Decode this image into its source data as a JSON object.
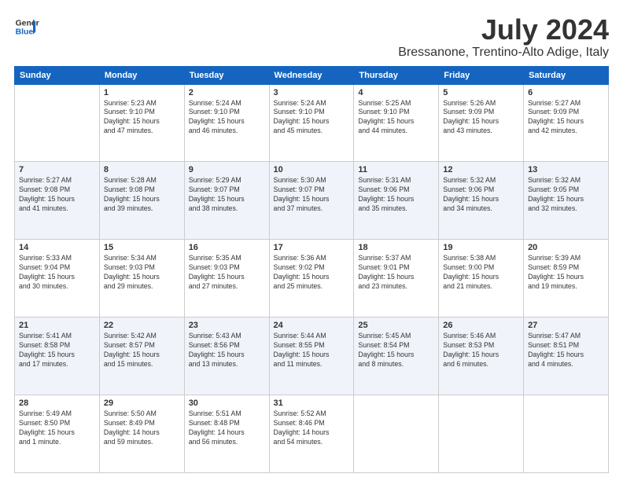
{
  "header": {
    "logo_line1": "General",
    "logo_line2": "Blue",
    "title": "July 2024",
    "subtitle": "Bressanone, Trentino-Alto Adige, Italy"
  },
  "columns": [
    "Sunday",
    "Monday",
    "Tuesday",
    "Wednesday",
    "Thursday",
    "Friday",
    "Saturday"
  ],
  "weeks": [
    [
      {
        "num": "",
        "info": ""
      },
      {
        "num": "1",
        "info": "Sunrise: 5:23 AM\nSunset: 9:10 PM\nDaylight: 15 hours\nand 47 minutes."
      },
      {
        "num": "2",
        "info": "Sunrise: 5:24 AM\nSunset: 9:10 PM\nDaylight: 15 hours\nand 46 minutes."
      },
      {
        "num": "3",
        "info": "Sunrise: 5:24 AM\nSunset: 9:10 PM\nDaylight: 15 hours\nand 45 minutes."
      },
      {
        "num": "4",
        "info": "Sunrise: 5:25 AM\nSunset: 9:10 PM\nDaylight: 15 hours\nand 44 minutes."
      },
      {
        "num": "5",
        "info": "Sunrise: 5:26 AM\nSunset: 9:09 PM\nDaylight: 15 hours\nand 43 minutes."
      },
      {
        "num": "6",
        "info": "Sunrise: 5:27 AM\nSunset: 9:09 PM\nDaylight: 15 hours\nand 42 minutes."
      }
    ],
    [
      {
        "num": "7",
        "info": "Sunrise: 5:27 AM\nSunset: 9:08 PM\nDaylight: 15 hours\nand 41 minutes."
      },
      {
        "num": "8",
        "info": "Sunrise: 5:28 AM\nSunset: 9:08 PM\nDaylight: 15 hours\nand 39 minutes."
      },
      {
        "num": "9",
        "info": "Sunrise: 5:29 AM\nSunset: 9:07 PM\nDaylight: 15 hours\nand 38 minutes."
      },
      {
        "num": "10",
        "info": "Sunrise: 5:30 AM\nSunset: 9:07 PM\nDaylight: 15 hours\nand 37 minutes."
      },
      {
        "num": "11",
        "info": "Sunrise: 5:31 AM\nSunset: 9:06 PM\nDaylight: 15 hours\nand 35 minutes."
      },
      {
        "num": "12",
        "info": "Sunrise: 5:32 AM\nSunset: 9:06 PM\nDaylight: 15 hours\nand 34 minutes."
      },
      {
        "num": "13",
        "info": "Sunrise: 5:32 AM\nSunset: 9:05 PM\nDaylight: 15 hours\nand 32 minutes."
      }
    ],
    [
      {
        "num": "14",
        "info": "Sunrise: 5:33 AM\nSunset: 9:04 PM\nDaylight: 15 hours\nand 30 minutes."
      },
      {
        "num": "15",
        "info": "Sunrise: 5:34 AM\nSunset: 9:03 PM\nDaylight: 15 hours\nand 29 minutes."
      },
      {
        "num": "16",
        "info": "Sunrise: 5:35 AM\nSunset: 9:03 PM\nDaylight: 15 hours\nand 27 minutes."
      },
      {
        "num": "17",
        "info": "Sunrise: 5:36 AM\nSunset: 9:02 PM\nDaylight: 15 hours\nand 25 minutes."
      },
      {
        "num": "18",
        "info": "Sunrise: 5:37 AM\nSunset: 9:01 PM\nDaylight: 15 hours\nand 23 minutes."
      },
      {
        "num": "19",
        "info": "Sunrise: 5:38 AM\nSunset: 9:00 PM\nDaylight: 15 hours\nand 21 minutes."
      },
      {
        "num": "20",
        "info": "Sunrise: 5:39 AM\nSunset: 8:59 PM\nDaylight: 15 hours\nand 19 minutes."
      }
    ],
    [
      {
        "num": "21",
        "info": "Sunrise: 5:41 AM\nSunset: 8:58 PM\nDaylight: 15 hours\nand 17 minutes."
      },
      {
        "num": "22",
        "info": "Sunrise: 5:42 AM\nSunset: 8:57 PM\nDaylight: 15 hours\nand 15 minutes."
      },
      {
        "num": "23",
        "info": "Sunrise: 5:43 AM\nSunset: 8:56 PM\nDaylight: 15 hours\nand 13 minutes."
      },
      {
        "num": "24",
        "info": "Sunrise: 5:44 AM\nSunset: 8:55 PM\nDaylight: 15 hours\nand 11 minutes."
      },
      {
        "num": "25",
        "info": "Sunrise: 5:45 AM\nSunset: 8:54 PM\nDaylight: 15 hours\nand 8 minutes."
      },
      {
        "num": "26",
        "info": "Sunrise: 5:46 AM\nSunset: 8:53 PM\nDaylight: 15 hours\nand 6 minutes."
      },
      {
        "num": "27",
        "info": "Sunrise: 5:47 AM\nSunset: 8:51 PM\nDaylight: 15 hours\nand 4 minutes."
      }
    ],
    [
      {
        "num": "28",
        "info": "Sunrise: 5:49 AM\nSunset: 8:50 PM\nDaylight: 15 hours\nand 1 minute."
      },
      {
        "num": "29",
        "info": "Sunrise: 5:50 AM\nSunset: 8:49 PM\nDaylight: 14 hours\nand 59 minutes."
      },
      {
        "num": "30",
        "info": "Sunrise: 5:51 AM\nSunset: 8:48 PM\nDaylight: 14 hours\nand 56 minutes."
      },
      {
        "num": "31",
        "info": "Sunrise: 5:52 AM\nSunset: 8:46 PM\nDaylight: 14 hours\nand 54 minutes."
      },
      {
        "num": "",
        "info": ""
      },
      {
        "num": "",
        "info": ""
      },
      {
        "num": "",
        "info": ""
      }
    ]
  ]
}
